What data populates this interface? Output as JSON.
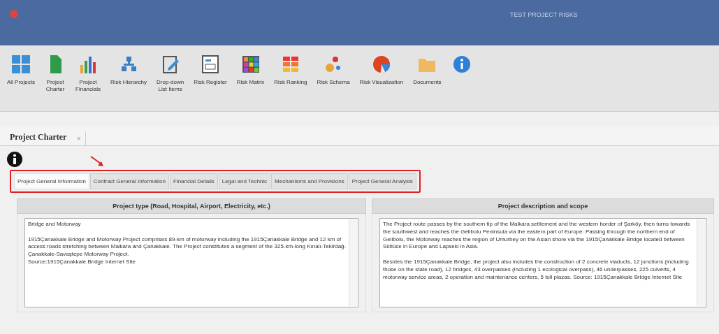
{
  "window": {
    "title": "TEST PROJECT RISKS"
  },
  "ribbon": [
    {
      "label": "All Projects",
      "kind": "grid"
    },
    {
      "label": "Project\nCharter",
      "kind": "doc"
    },
    {
      "label": "Project\nFinancials",
      "kind": "bars"
    },
    {
      "label": "Risk Hierarchy",
      "kind": "hierarchy"
    },
    {
      "label": "Drop-down\nList Items",
      "kind": "edit"
    },
    {
      "label": "Risk Register",
      "kind": "register"
    },
    {
      "label": "Risk Matrix",
      "kind": "matrix"
    },
    {
      "label": "Risk Ranking",
      "kind": "ranking"
    },
    {
      "label": "Risk Schema",
      "kind": "schema"
    },
    {
      "label": "Risk Visualization",
      "kind": "pie"
    },
    {
      "label": "Documents",
      "kind": "folder"
    },
    {
      "kind": "info"
    }
  ],
  "document_tab": {
    "label": "Project Charter",
    "close": "×"
  },
  "tabs": [
    {
      "label": "Project General Information",
      "selected": true
    },
    {
      "label": "Contract General Information",
      "selected": false
    },
    {
      "label": "Financial Details",
      "selected": false
    },
    {
      "label": "Legal and Technic",
      "selected": false
    },
    {
      "label": "Mechanisms and Provisions",
      "selected": false
    },
    {
      "label": "Project General Analysis",
      "selected": false
    }
  ],
  "panels": [
    {
      "heading": "Project type (Road, Hospital, Airport, Electricity, etc.)",
      "value": "Bridge and Motorway\n\n1915Çanakkale Bridge and Motorway Project comprises 89-km of motorway including the 1915Çanakkale Bridge and 12 km of access roads stretching between Malkara and Çanakkale. The Project constitutes a segment of the 325-km-long Kınalı-Tekirdağ-Çanakkale-Savaştepe Motorway Project.\nSource:1915Çanakkale Bridge Internet Site"
    },
    {
      "heading": "Project description and scope",
      "value": "The Project route passes by the southern tip of the Malkara settlement and the western border of Şarköy, then turns towards the southwest and reaches the Gelibolu Peninsula via the eastern part of Europe. Passing through the northern end of Gelibolu, the Motorway reaches the region of Umurbey on the Asian shore via the 1915Çanakkale Bridge located between Sütlüce in Europe and Lapseki in Asia.\n\nBesides the 1915Çanakkale Bridge, the project also includes the construction of 2 concrete viaducts, 12 junctions (including those on the state road), 12 bridges, 43 overpasses (including 1 ecological overpass), 46 underpasses, 225 culverts, 4 motorway service areas, 2 operation and maintenance centers, 5 toll plazas. Source: 1915Çanakkale Bridge Internet Site"
    }
  ]
}
